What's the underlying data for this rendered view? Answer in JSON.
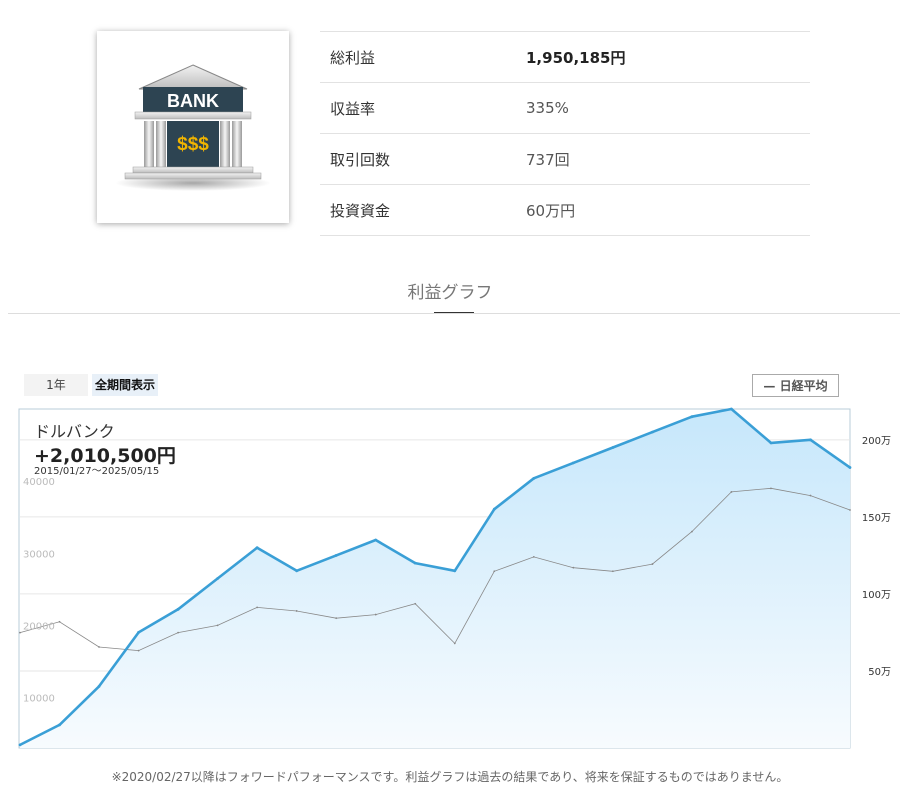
{
  "logo": {
    "sign_text": "BANK",
    "money_text": "$$$"
  },
  "stats": [
    {
      "label": "総利益",
      "value": "1,950,185円"
    },
    {
      "label": "収益率",
      "value": "335%"
    },
    {
      "label": "取引回数",
      "value": "737回"
    },
    {
      "label": "投資資金",
      "value": "60万円"
    }
  ],
  "section": {
    "title": "利益グラフ"
  },
  "controls": {
    "range_1y": "1年",
    "range_all": "全期間表示",
    "legend_nikkei": "— 日経平均"
  },
  "chart_header": {
    "name": "ドルバンク",
    "total": "+2,010,500円",
    "period": "2015/01/27〜2025/05/15"
  },
  "footnote": "※2020/02/27以降はフォワードパフォーマンスです。利益グラフは過去の結果であり、将来を保証するものではありません。",
  "colors": {
    "profit_line": "#3a9fd6",
    "profit_fill": "#cde9fa",
    "nikkei_line": "#888888",
    "frame": "#b8ccd8"
  },
  "chart_data": {
    "type": "area",
    "x_range": [
      "2015/01/27",
      "2025/05/15"
    ],
    "x": [
      "2015",
      "2015.5",
      "2016",
      "2016.5",
      "2017",
      "2017.5",
      "2018",
      "2018.5",
      "2019",
      "2019.5",
      "2020",
      "2020.5",
      "2021",
      "2021.5",
      "2022",
      "2022.5",
      "2023",
      "2023.5",
      "2024",
      "2024.5",
      "2025",
      "2025.4"
    ],
    "right_axis": {
      "ticks": [
        50,
        100,
        150,
        200
      ],
      "tick_labels": [
        "50万",
        "100万",
        "150万",
        "200万"
      ],
      "ylim": [
        0,
        220
      ]
    },
    "left_axis": {
      "ticks": [
        10000,
        20000,
        30000,
        40000
      ],
      "tick_labels": [
        "10000",
        "20000",
        "30000",
        "40000"
      ],
      "ylim": [
        3000,
        50000
      ]
    },
    "series": [
      {
        "name": "ドルバンク",
        "axis": "right",
        "values": [
          2,
          15,
          40,
          75,
          90,
          110,
          130,
          115,
          125,
          135,
          120,
          115,
          155,
          175,
          185,
          195,
          205,
          215,
          220,
          198,
          200,
          182
        ]
      },
      {
        "name": "日経平均",
        "axis": "left",
        "values": [
          19000,
          20500,
          17000,
          16500,
          19000,
          20000,
          22500,
          22000,
          21000,
          21500,
          23000,
          17500,
          27500,
          29500,
          28000,
          27500,
          28500,
          33000,
          38500,
          39000,
          38000,
          36000
        ]
      }
    ]
  }
}
